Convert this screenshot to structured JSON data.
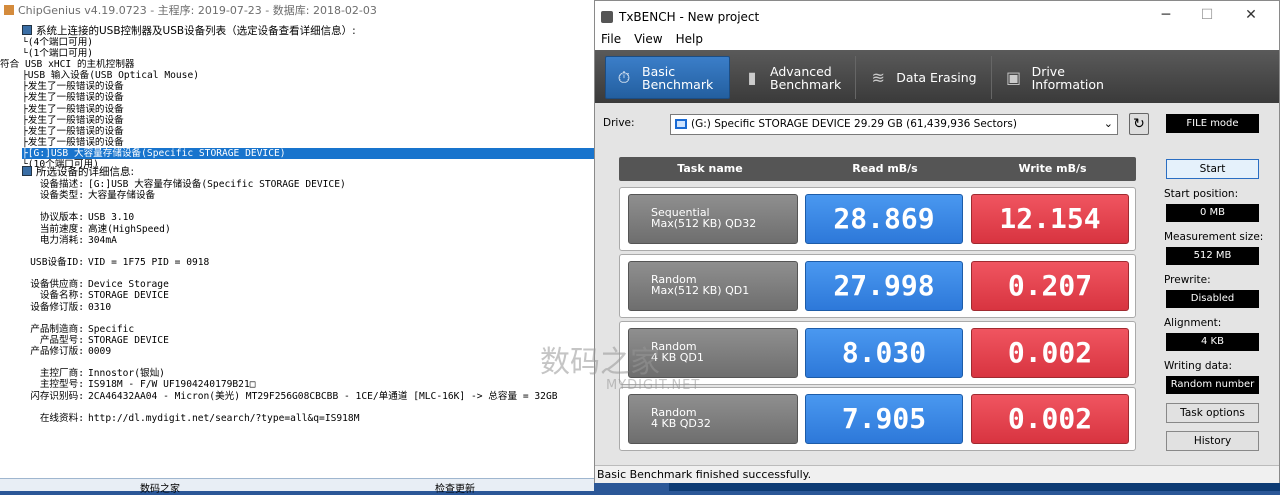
{
  "chipgenius": {
    "title": "ChipGenius v4.19.0723 - 主程序: 2019-07-23 - 数据库: 2018-02-03",
    "tree_header": "系统上连接的USB控制器及USB设备列表（选定设备查看详细信息）:",
    "tree": [
      "└(4个端口可用)",
      "└(1个端口可用)",
      "符合 USB xHCI 的主机控制器",
      "├USB 输入设备(USB Optical Mouse)",
      "├发生了一般错误的设备",
      "├发生了一般错误的设备",
      "├发生了一般错误的设备",
      "├发生了一般错误的设备",
      "├发生了一般错误的设备",
      "├发生了一般错误的设备",
      "├[G:]USB 大容量存储设备(Specific STORAGE DEVICE)",
      "└(10个端口可用)"
    ],
    "detail_header": "所选设备的详细信息:",
    "details": {
      "desc_k": "设备描述:",
      "desc_v": "[G:]USB 大容量存储设备(Specific STORAGE DEVICE)",
      "type_k": "设备类型:",
      "type_v": "大容量存储设备",
      "proto_k": "协议版本:",
      "proto_v": "USB 3.10",
      "speed_k": "当前速度:",
      "speed_v": "高速(HighSpeed)",
      "power_k": "电力消耗:",
      "power_v": "304mA",
      "id_k": "USB设备ID:",
      "id_v": "VID = 1F75 PID = 0918",
      "vendor_k": "设备供应商:",
      "vendor_v": "Device Storage",
      "devname_k": "设备名称:",
      "devname_v": "STORAGE DEVICE",
      "rev_k": "设备修订版:",
      "rev_v": "0310",
      "mfr_k": "产品制造商:",
      "mfr_v": "Specific",
      "model_k": "产品型号:",
      "model_v": "STORAGE DEVICE",
      "prev_k": "产品修订版:",
      "prev_v": "0009",
      "ctrl_k": "主控厂商:",
      "ctrl_v": "Innostor(银灿)",
      "ctrlm_k": "主控型号:",
      "ctrlm_v": "IS918M - F/W UF1904240179B21□",
      "flash_k": "闪存识别码:",
      "flash_v": "2CA46432AA04 - Micron(美光) MT29F256G08CBCBB - 1CE/单通道 [MLC-16K] -> 总容量 = 32GB",
      "online_k": "在线资料:",
      "online_v": "http://dl.mydigit.net/search/?type=all&q=IS918M"
    },
    "bottom_left": "数码之家",
    "bottom_right": "检查更新",
    "watermark": "数码之家",
    "watermark_url": "MYDIGIT.NET"
  },
  "txbench": {
    "title": "TxBENCH - New project",
    "menu": [
      "File",
      "View",
      "Help"
    ],
    "tabs": [
      {
        "l1": "Basic",
        "l2": "Benchmark",
        "icon": "stopwatch-icon"
      },
      {
        "l1": "Advanced",
        "l2": "Benchmark",
        "icon": "bars-icon"
      },
      {
        "l1": "Data Erasing",
        "l2": "",
        "icon": "eraser-icon"
      },
      {
        "l1": "Drive",
        "l2": "Information",
        "icon": "drive-icon"
      }
    ],
    "drive_label": "Drive:",
    "drive_value": "(G:) Specific STORAGE DEVICE  29.29 GB (61,439,936 Sectors)",
    "mode": "FILE mode",
    "headers": {
      "task": "Task name",
      "read": "Read mB/s",
      "write": "Write mB/s"
    },
    "rows": [
      {
        "l1": "Sequential",
        "l2": "Max(512 KB) QD32",
        "read": "28.869",
        "write": "12.154"
      },
      {
        "l1": "Random",
        "l2": "Max(512 KB) QD1",
        "read": "27.998",
        "write": "0.207"
      },
      {
        "l1": "Random",
        "l2": "4 KB QD1",
        "read": "8.030",
        "write": "0.002"
      },
      {
        "l1": "Random",
        "l2": "4 KB QD32",
        "read": "7.905",
        "write": "0.002"
      }
    ],
    "start": "Start",
    "start_pos_label": "Start position:",
    "start_pos": "0 MB",
    "meas_label": "Measurement size:",
    "meas": "512 MB",
    "prewrite_label": "Prewrite:",
    "prewrite": "Disabled",
    "align_label": "Alignment:",
    "align": "4 KB",
    "writing_label": "Writing data:",
    "writing": "Random number",
    "task_options": "Task options",
    "history": "History",
    "status": "Basic Benchmark finished successfully."
  }
}
